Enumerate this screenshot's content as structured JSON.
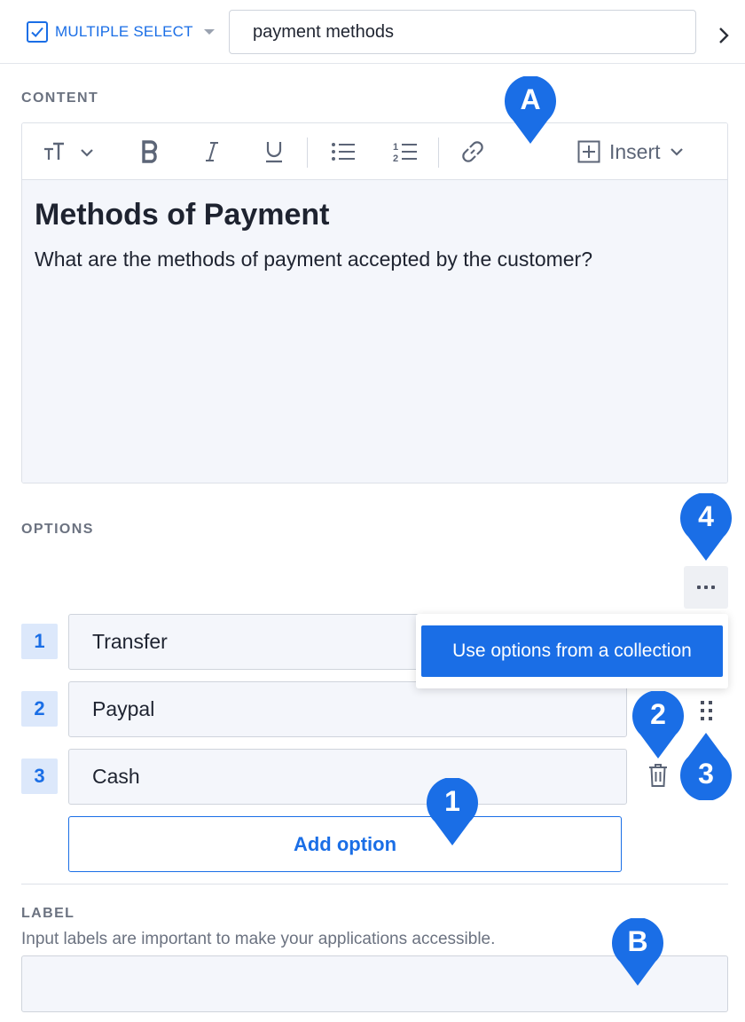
{
  "header": {
    "type_label": "MULTIPLE SELECT",
    "name_value": "payment methods"
  },
  "content": {
    "section_label": "CONTENT",
    "insert_label": "Insert",
    "title": "Methods of Payment",
    "body": "What are the methods of payment accepted by the customer?"
  },
  "options": {
    "section_label": "OPTIONS",
    "items": [
      {
        "number": "1",
        "value": "Transfer"
      },
      {
        "number": "2",
        "value": "Paypal"
      },
      {
        "number": "3",
        "value": "Cash"
      }
    ],
    "add_label": "Add option",
    "menu_item": "Use options from a collection"
  },
  "label_field": {
    "section_label": "LABEL",
    "help_text": "Input labels are important to make your applications accessible.",
    "value": ""
  },
  "markers": {
    "a": "A",
    "b": "B",
    "m1": "1",
    "m2": "2",
    "m3": "3",
    "m4": "4"
  },
  "colors": {
    "accent": "#1a6ee6",
    "marker": "#1a6ee6",
    "editor_bg": "#f4f6fb",
    "number_badge_bg": "#dce8fb"
  },
  "icons": {
    "type_checkbox": "checkbox-checked-icon",
    "text_size": "text-size-icon",
    "bold": "bold-icon",
    "italic": "italic-icon",
    "underline": "underline-icon",
    "bullet_list": "bullet-list-icon",
    "numbered_list": "numbered-list-icon",
    "link": "link-icon",
    "insert": "plus-square-icon",
    "more": "more-horizontal-icon",
    "drag": "drag-handle-icon",
    "delete": "trash-icon",
    "expand": "chevron-right-icon"
  }
}
